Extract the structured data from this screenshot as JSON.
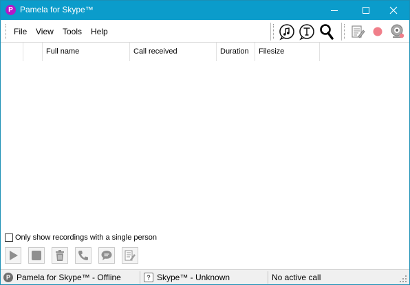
{
  "window": {
    "title": "Pamela for Skype™",
    "app_icon_letter": "P"
  },
  "menu": {
    "items": [
      "File",
      "View",
      "Tools",
      "Help"
    ]
  },
  "toolbar": {
    "icons": [
      "music-note-icon",
      "text-icon",
      "search-icon",
      "notes-icon",
      "record-icon",
      "webcam-icon"
    ],
    "record_color": "#f07f8a"
  },
  "list": {
    "columns": [
      "",
      "",
      "Full name",
      "Call received",
      "Duration",
      "Filesize"
    ]
  },
  "filter": {
    "label": "Only show recordings with a single person",
    "checked": false
  },
  "bottom_buttons": [
    "play-icon",
    "stop-icon",
    "trash-icon",
    "phone-icon",
    "chat-icon",
    "notes-icon"
  ],
  "status": {
    "app_status": "Pamela for Skype™ - Offline",
    "skype_status": "Skype™ - Unknown",
    "call_status": "No active call",
    "skype_icon_glyph": "?"
  },
  "colors": {
    "titlebar": "#0b9ccb",
    "app_icon": "#b417c8"
  }
}
